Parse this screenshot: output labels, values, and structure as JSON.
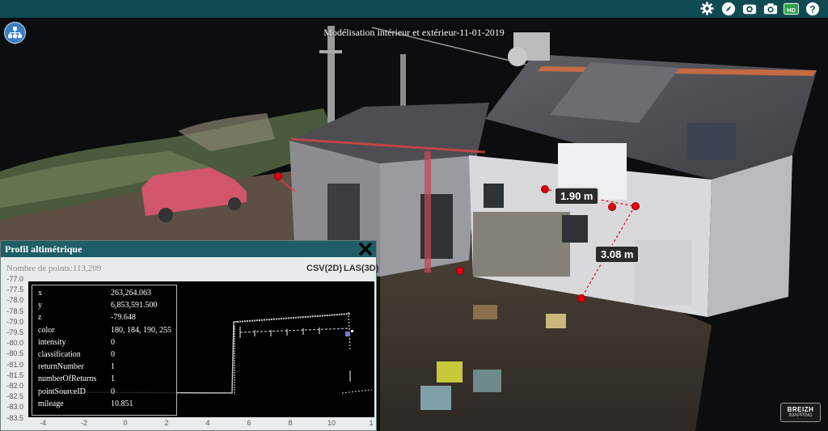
{
  "scene": {
    "title": "Modélisation intérieur et extérieur-11-01-2019",
    "measurements": [
      "1.90 m",
      "3.08 m"
    ]
  },
  "toolbar": {
    "icons": [
      "gear-icon",
      "compass-icon",
      "panorama-icon",
      "camera-icon",
      "hd-icon",
      "help-icon"
    ],
    "hd_label": "HD",
    "help_label": "?"
  },
  "profile": {
    "title": "Profil altimétrique",
    "points_label": "Nombre de points:113,209",
    "export_csv": "CSV(2D)",
    "export_las": "LAS(3D)",
    "y_ticks": [
      "-77.0",
      "-77.5",
      "-78.0",
      "-78.5",
      "-79.0",
      "-79.5",
      "-80.0",
      "-80.5",
      "-81.0",
      "-81.5",
      "-82.0",
      "-82.5",
      "-83.0",
      "-83.5"
    ],
    "x_ticks": [
      "-4",
      "-2",
      "0",
      "2",
      "4",
      "6",
      "8",
      "10",
      "1"
    ],
    "info": [
      {
        "key": "x",
        "value": "263,264.063"
      },
      {
        "key": "y",
        "value": "6,853,591.500"
      },
      {
        "key": "z",
        "value": "-79.648"
      },
      {
        "key": "color",
        "value": "180, 184, 190, 255"
      },
      {
        "key": "intensity",
        "value": "0"
      },
      {
        "key": "classification",
        "value": "0"
      },
      {
        "key": "returnNumber",
        "value": "1"
      },
      {
        "key": "numberOfReturns",
        "value": "1"
      },
      {
        "key": "pointSourceID",
        "value": "0"
      },
      {
        "key": "mileage",
        "value": "10.851"
      }
    ]
  },
  "logo": {
    "line1": "BREIZH",
    "line2": "IMAPPING"
  },
  "colors": {
    "topbar": "#0f4a52",
    "panel_header": "#1f5e66",
    "measure_point": "#e00010"
  }
}
